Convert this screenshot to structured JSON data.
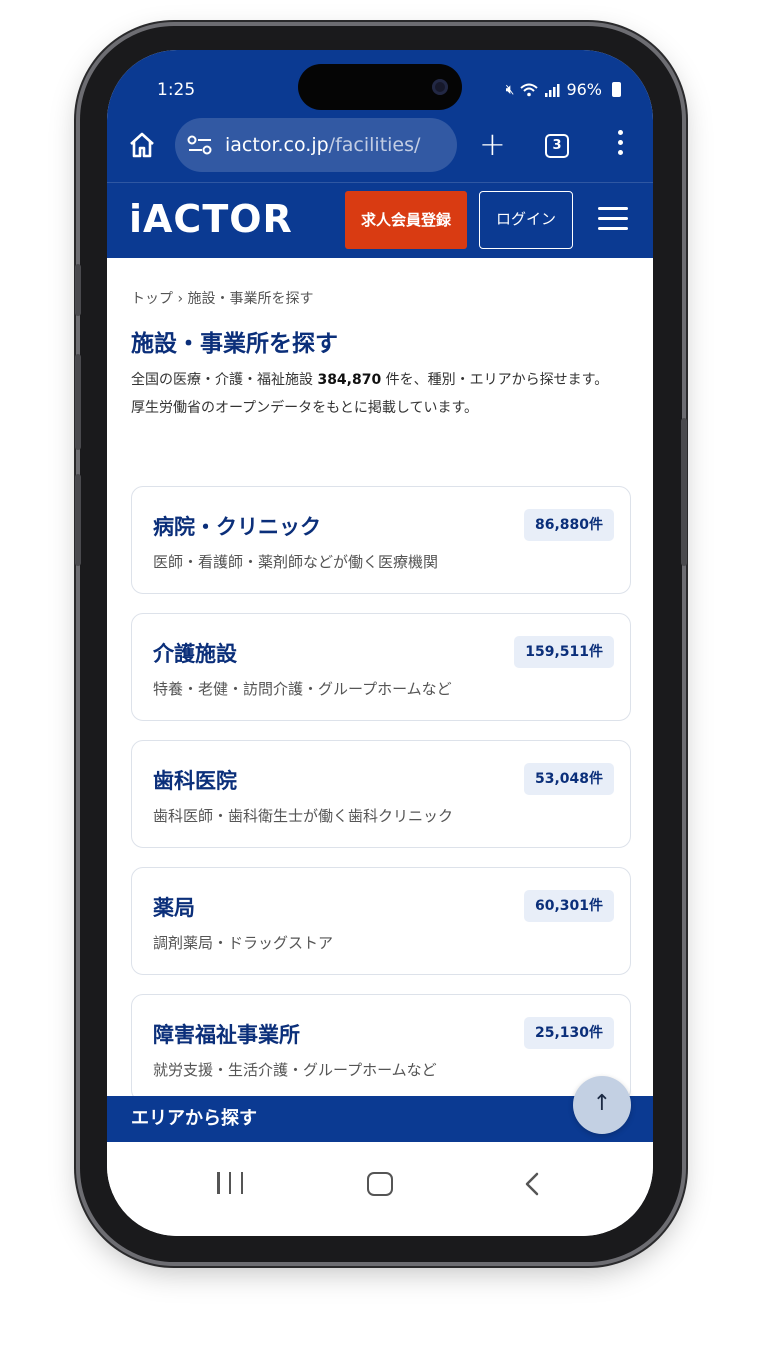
{
  "status": {
    "time": "1:25",
    "battery": "96%"
  },
  "browser": {
    "url_main": "iactor.co.jp",
    "url_path": "/facilities/",
    "tab_count": "3"
  },
  "site": {
    "logo": "iACTOR",
    "register_label": "求人会員登録",
    "login_label": "ログイン"
  },
  "breadcrumb": "トップ › 施設・事業所を探す",
  "page": {
    "title": "施設・事業所を探す",
    "intro_prefix": "全国の医療・介護・福祉施設 ",
    "intro_total": "384,870",
    "intro_suffix": " 件を、種別・エリアから探せます。",
    "intro_line2": "厚生労働省のオープンデータをもとに掲載しています。"
  },
  "categories": [
    {
      "title": "病院・クリニック",
      "desc": "医師・看護師・薬剤師などが働く医療機関",
      "count": "86,880件"
    },
    {
      "title": "介護施設",
      "desc": "特養・老健・訪問介護・グループホームなど",
      "count": "159,511件"
    },
    {
      "title": "歯科医院",
      "desc": "歯科医師・歯科衛生士が働く歯科クリニック",
      "count": "53,048件"
    },
    {
      "title": "薬局",
      "desc": "調剤薬局・ドラッグストア",
      "count": "60,301件"
    },
    {
      "title": "障害福祉事業所",
      "desc": "就労支援・生活介護・グループホームなど",
      "count": "25,130件"
    }
  ],
  "area_section": {
    "title": "エリアから探す"
  },
  "scroll_top_label": "↑",
  "colors": {
    "brand_blue": "#0b3a92",
    "register_orange": "#d93b12",
    "title_navy": "#0b2f7a"
  }
}
